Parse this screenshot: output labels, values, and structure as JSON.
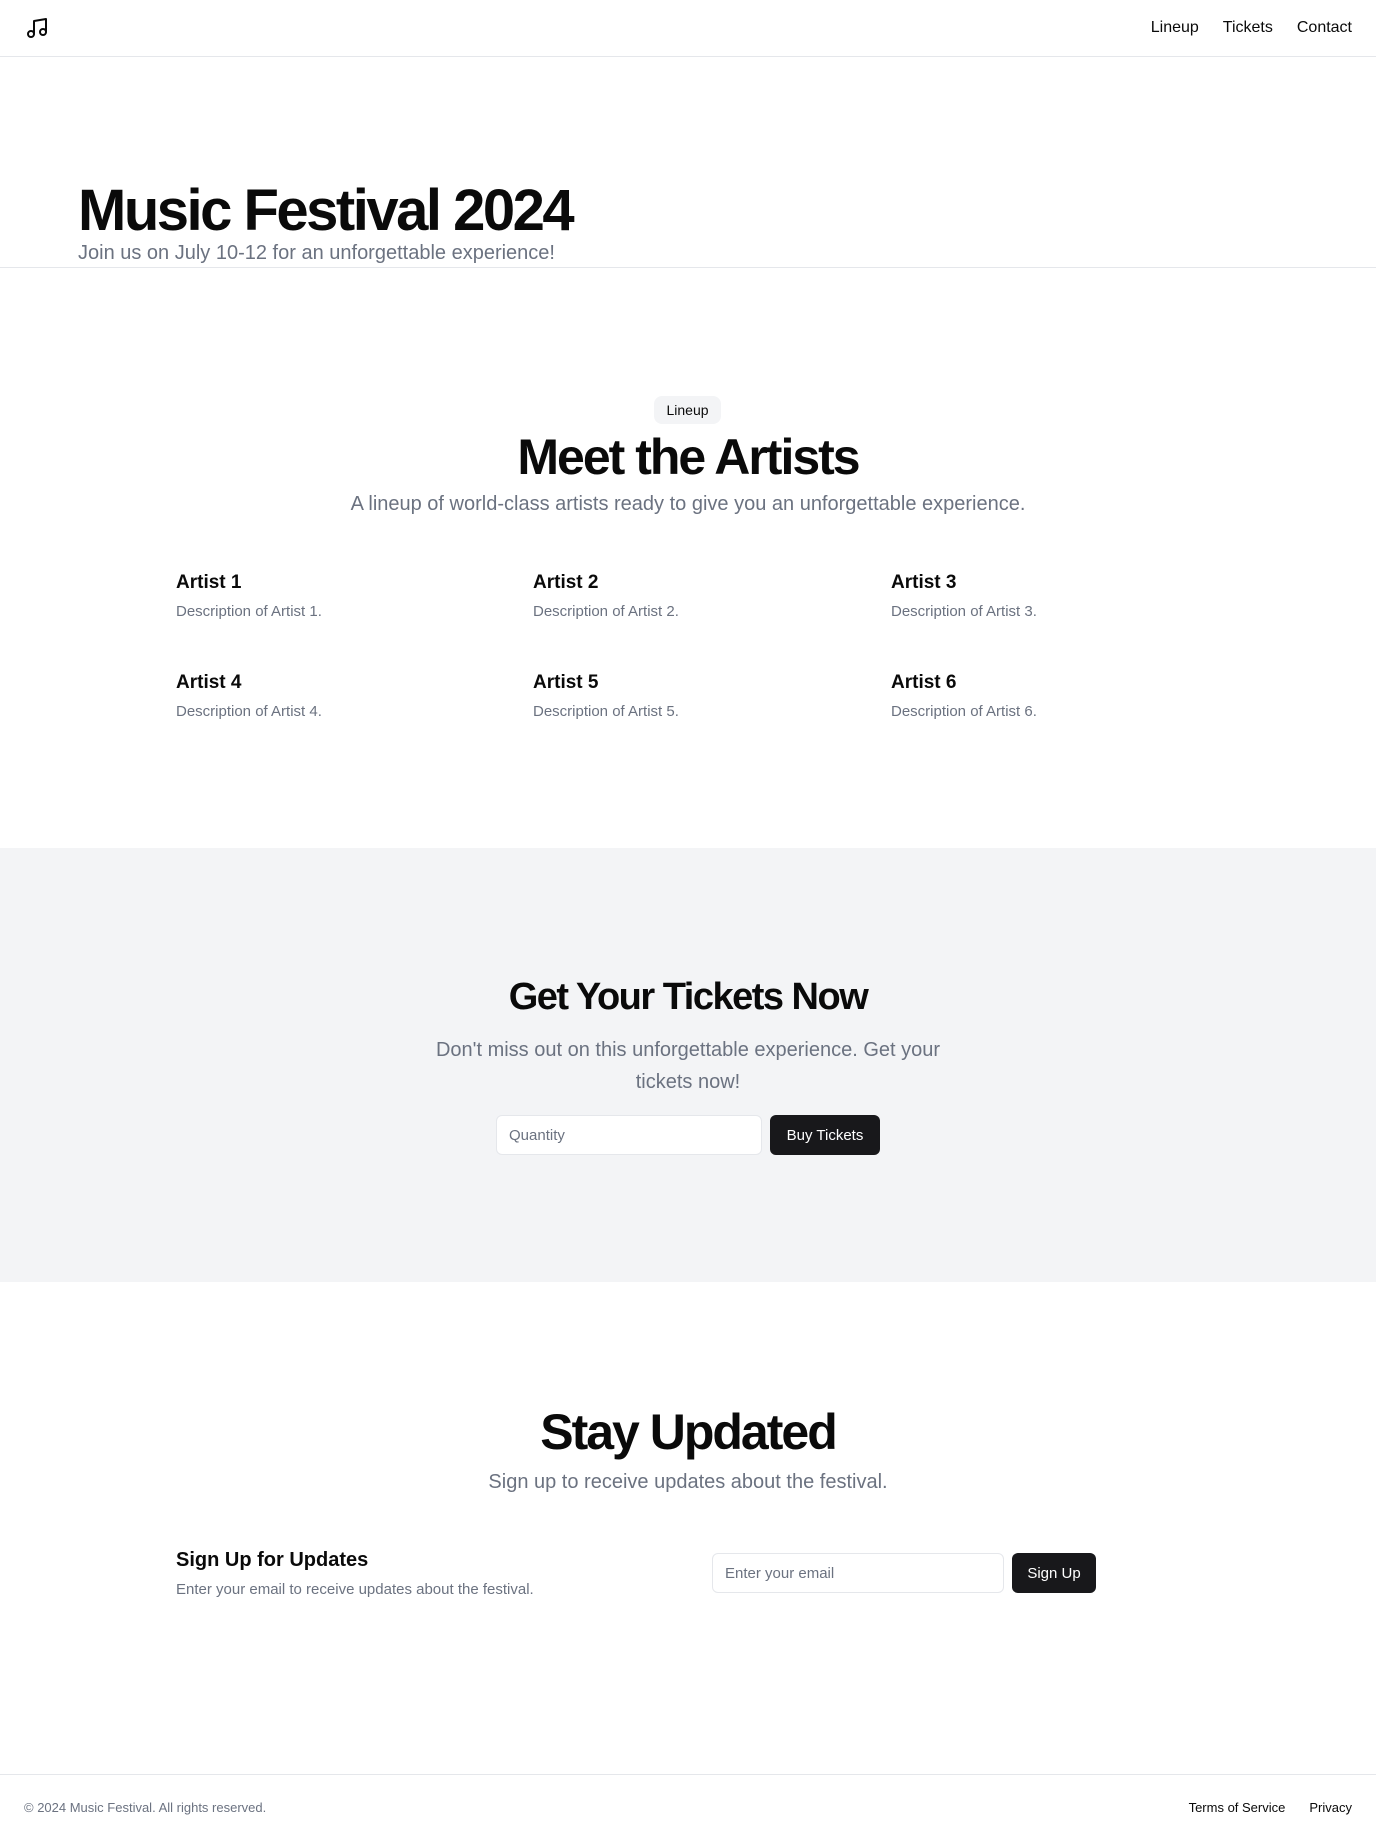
{
  "header": {
    "logo_icon": "music-note-icon",
    "nav": [
      {
        "label": "Lineup"
      },
      {
        "label": "Tickets"
      },
      {
        "label": "Contact"
      }
    ]
  },
  "hero": {
    "title": "Music Festival 2024",
    "subtitle": "Join us on July 10-12 for an unforgettable experience!"
  },
  "lineup": {
    "badge": "Lineup",
    "title": "Meet the Artists",
    "subtitle": "A lineup of world-class artists ready to give you an unforgettable experience.",
    "artists": [
      {
        "name": "Artist 1",
        "description": "Description of Artist 1."
      },
      {
        "name": "Artist 2",
        "description": "Description of Artist 2."
      },
      {
        "name": "Artist 3",
        "description": "Description of Artist 3."
      },
      {
        "name": "Artist 4",
        "description": "Description of Artist 4."
      },
      {
        "name": "Artist 5",
        "description": "Description of Artist 5."
      },
      {
        "name": "Artist 6",
        "description": "Description of Artist 6."
      }
    ]
  },
  "tickets": {
    "title": "Get Your Tickets Now",
    "subtitle": "Don't miss out on this unforgettable experience. Get your tickets now!",
    "quantity_value": "",
    "quantity_placeholder": "Quantity",
    "button_label": "Buy Tickets"
  },
  "updates": {
    "title": "Stay Updated",
    "subtitle": "Sign up to receive updates about the festival.",
    "signup_title": "Sign Up for Updates",
    "signup_description": "Enter your email to receive updates about the festival.",
    "email_value": "",
    "email_placeholder": "Enter your email",
    "button_label": "Sign Up"
  },
  "footer": {
    "copyright": "© 2024 Music Festival. All rights reserved.",
    "links": [
      {
        "label": "Terms of Service"
      },
      {
        "label": "Privacy"
      }
    ]
  },
  "colors": {
    "text": "#0a0a0a",
    "muted": "#6b7280",
    "border": "#e5e7eb",
    "section_bg": "#f3f4f6",
    "button_bg": "#18181b",
    "button_text": "#ffffff"
  }
}
